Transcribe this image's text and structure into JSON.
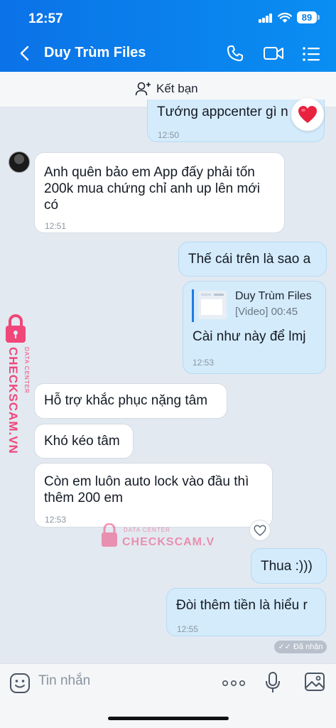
{
  "status": {
    "time": "12:57",
    "battery": "89"
  },
  "header": {
    "title": "Duy Trùm Files"
  },
  "friend_bar": {
    "label": "Kết bạn"
  },
  "messages": [
    {
      "side": "out",
      "text": "Tướng appcenter gì n",
      "time": "12:50"
    },
    {
      "side": "in",
      "lines": [
        "Anh quên bảo em App đấy phải tốn",
        "200k mua chứng chỉ anh up lên mới",
        "có"
      ],
      "time": "12:51"
    },
    {
      "side": "out",
      "text": "Thế cái trên là sao a"
    },
    {
      "side": "out",
      "quote_name": "Duy Trùm Files",
      "quote_type": "[Video] 00:45",
      "text": "Cài như này để lmj",
      "time": "12:53"
    },
    {
      "side": "in",
      "text": "Hỗ trợ khắc phục nặng tâm"
    },
    {
      "side": "in",
      "text": "Khó kéo tâm"
    },
    {
      "side": "in",
      "lines": [
        "Còn em luôn auto lock vào đầu thì",
        "thêm 200 em"
      ],
      "time": "12:53"
    },
    {
      "side": "out",
      "text": "Thua :)))"
    },
    {
      "side": "out",
      "text": "Đòi thêm tiền là hiểu r",
      "time": "12:55"
    }
  ],
  "seen_label": "Đã nhận",
  "watermark": {
    "brand": "CHECKSCAM.VN",
    "tag": "DATA CENTER",
    "color": "#f0467a"
  },
  "composer": {
    "placeholder": "Tin nhắn"
  },
  "colors": {
    "header": "#0a7fe9",
    "outgoing": "#d4ebfb",
    "incoming": "#ffffff",
    "background": "#e2e9f1"
  }
}
